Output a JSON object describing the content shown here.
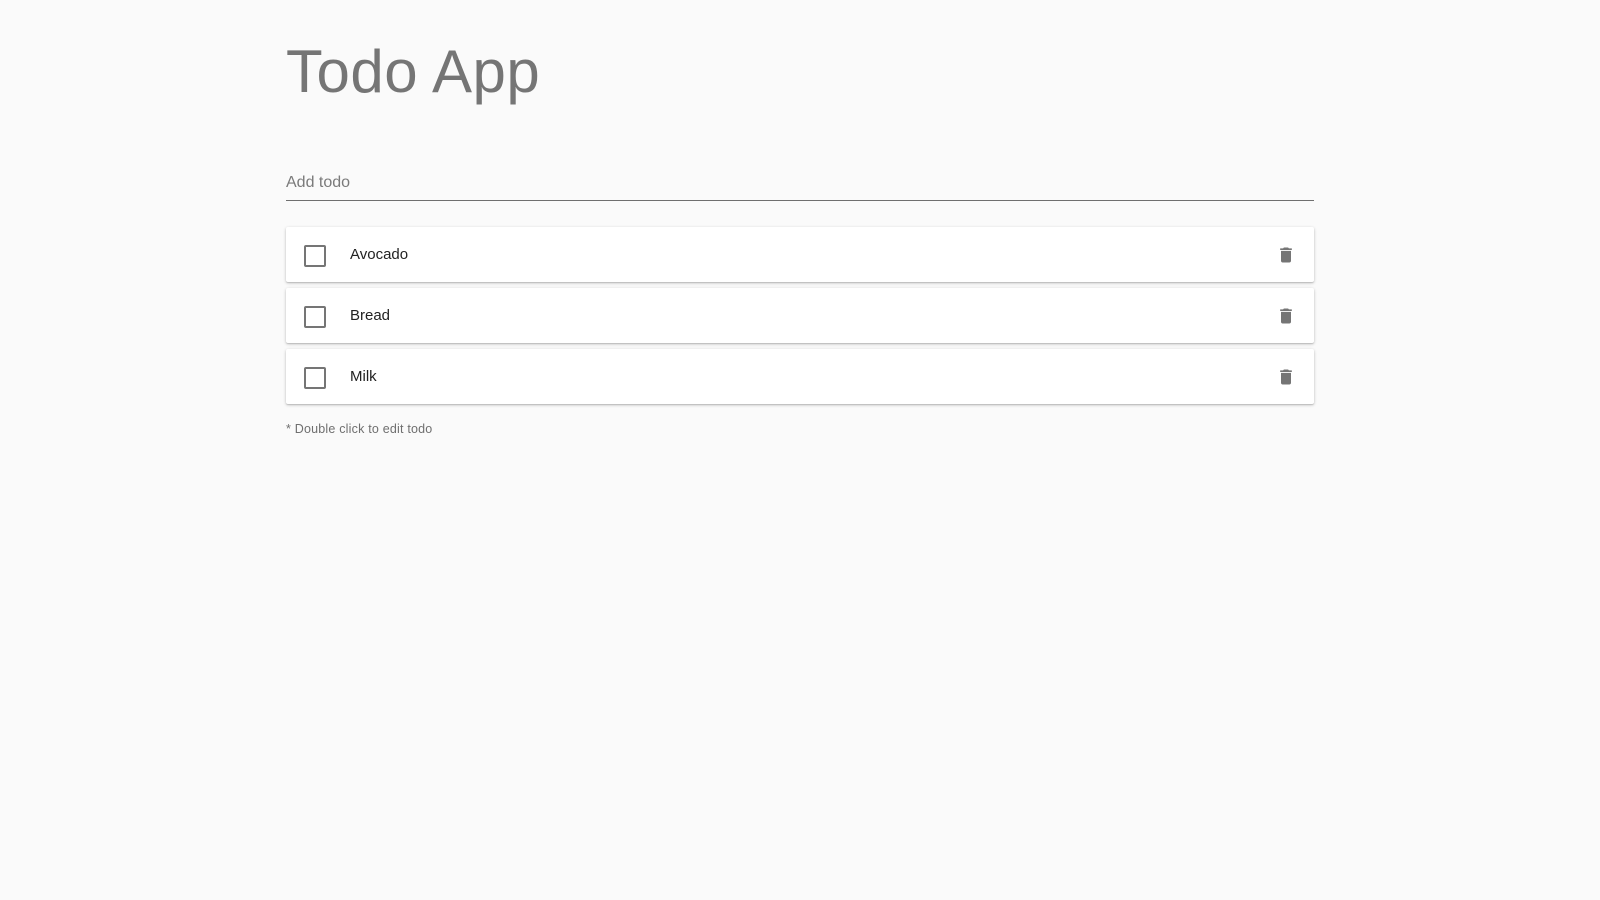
{
  "app": {
    "title": "Todo App"
  },
  "add_todo": {
    "placeholder": "Add todo",
    "value": ""
  },
  "todos": [
    {
      "label": "Avocado",
      "checked": false
    },
    {
      "label": "Bread",
      "checked": false
    },
    {
      "label": "Milk",
      "checked": false
    }
  ],
  "hint": "* Double click to edit todo",
  "icons": {
    "checkbox": "checkbox-unchecked-icon",
    "delete": "trash-icon"
  },
  "colors": {
    "background": "#fafafa",
    "title": "#757575",
    "card": "#ffffff",
    "icon": "#757575"
  }
}
